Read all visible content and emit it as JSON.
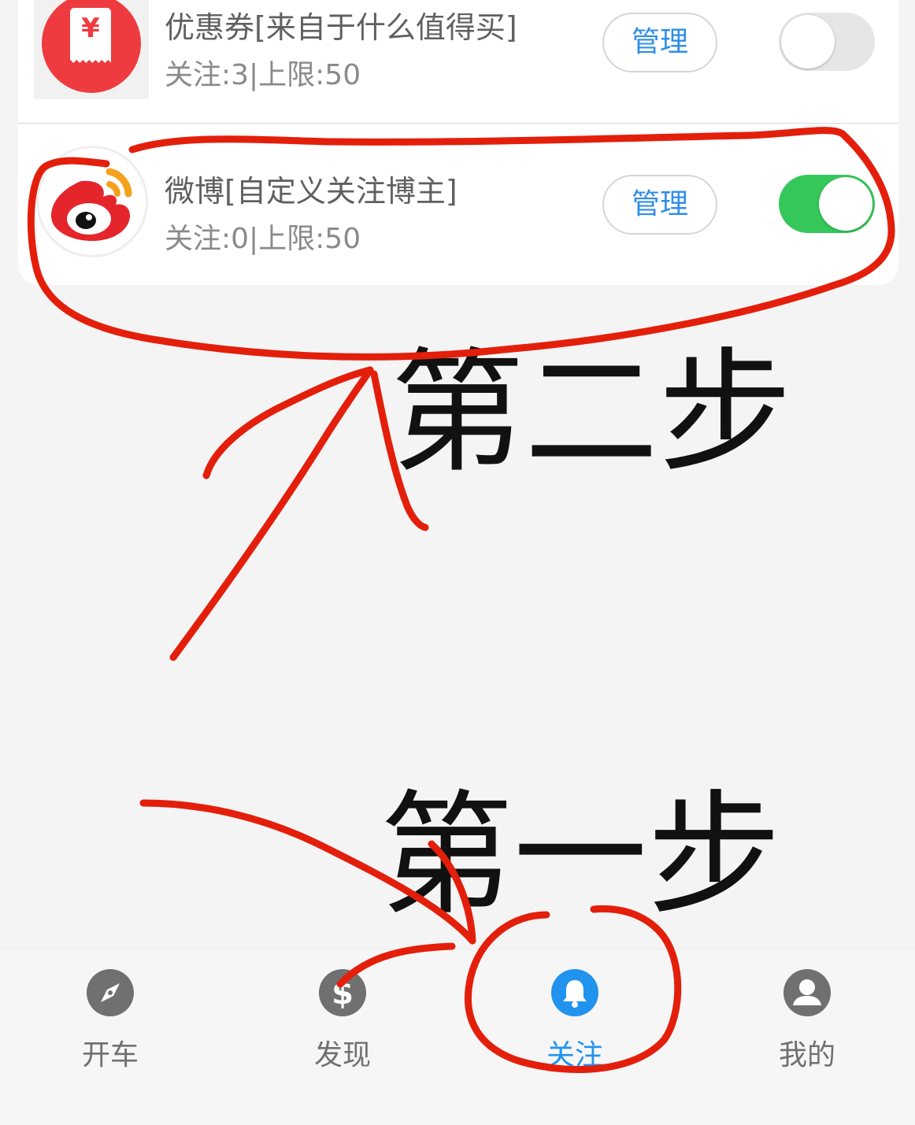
{
  "subscriptions": [
    {
      "title": "优惠券[来自于什么值得买]",
      "subtitle": "关注:3|上限:50",
      "icon": "coupon-icon",
      "icon_glyph": "¥",
      "manage_label": "管理",
      "enabled": false
    },
    {
      "title": "微博[自定义关注博主]",
      "subtitle": "关注:0|上限:50",
      "icon": "weibo-icon",
      "manage_label": "管理",
      "enabled": true
    }
  ],
  "annotations": {
    "step2": "第二步",
    "step1": "第一步",
    "color": "#e31f0b"
  },
  "bottom_nav": {
    "items": [
      {
        "label": "开车",
        "icon": "compass-icon"
      },
      {
        "label": "发现",
        "icon": "dollar-icon"
      },
      {
        "label": "关注",
        "icon": "bell-icon",
        "active": true
      },
      {
        "label": "我的",
        "icon": "user-icon"
      }
    ],
    "active_color": "#2193ee",
    "inactive_color": "#707070"
  },
  "colors": {
    "toggle_on": "#35c75a",
    "toggle_off": "#e6e6e6",
    "manage_text": "#2f8ee8",
    "coupon_red": "#ee3b3f"
  }
}
